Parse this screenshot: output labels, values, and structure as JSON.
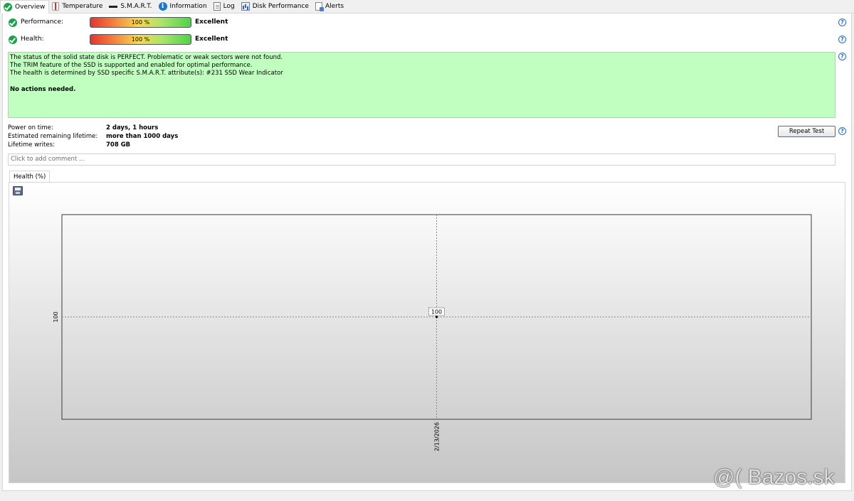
{
  "tabs": [
    {
      "label": "Overview",
      "icon": "check-circle-icon"
    },
    {
      "label": "Temperature",
      "icon": "thermometer-icon"
    },
    {
      "label": "S.M.A.R.T.",
      "icon": "smart-icon"
    },
    {
      "label": "Information",
      "icon": "info-icon"
    },
    {
      "label": "Log",
      "icon": "document-icon"
    },
    {
      "label": "Disk Performance",
      "icon": "performance-chart-icon"
    },
    {
      "label": "Alerts",
      "icon": "alerts-icon"
    }
  ],
  "performance": {
    "label": "Performance:",
    "bar_text": "100 %",
    "value": 100,
    "rating": "Excellent"
  },
  "health": {
    "label": "Health:",
    "bar_text": "100 %",
    "value": 100,
    "rating": "Excellent"
  },
  "status": {
    "line1": "The status of the solid state disk is PERFECT. Problematic or weak sectors were not found.",
    "line2": "The TRIM feature of the SSD is supported and enabled for optimal performance.",
    "line3": "The health is determined by SSD specific S.M.A.R.T. attribute(s):  #231 SSD Wear Indicator",
    "action": "No actions needed.",
    "background": "#c0ffc0"
  },
  "details": {
    "power_on_label": "Power on time:",
    "power_on_value": "2 days, 1 hours",
    "lifetime_label": "Estimated remaining lifetime:",
    "lifetime_value": "more than 1000 days",
    "writes_label": "Lifetime writes:",
    "writes_value": "708 GB"
  },
  "repeat_test_label": "Repeat Test",
  "comment_placeholder": "Click to add comment ...",
  "chart_tab_label": "Health (%)",
  "chart_data": {
    "type": "line",
    "x": [
      "2/13/2026"
    ],
    "series": [
      {
        "values": [
          100
        ]
      }
    ],
    "data_labels": [
      "100"
    ],
    "y_tick_labels": [
      "100"
    ],
    "grid": true
  },
  "watermark": "@( Bazos.sk"
}
